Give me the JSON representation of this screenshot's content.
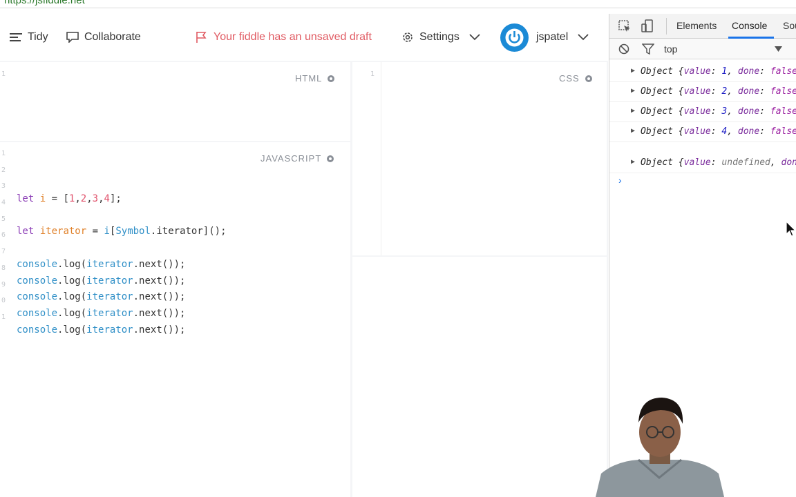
{
  "browser": {
    "url": "https://jsfiddle.net"
  },
  "toolbar": {
    "tidy": "Tidy",
    "collaborate": "Collaborate",
    "draft": "Your fiddle has an unsaved draft",
    "settings": "Settings",
    "user": "jspatel"
  },
  "panels": {
    "html_label": "HTML",
    "css_label": "CSS",
    "js_label": "JAVASCRIPT"
  },
  "line_numbers": {
    "html": [
      "1"
    ],
    "css": [
      "1"
    ],
    "js": [
      "1",
      "2",
      "3",
      "4",
      "5",
      "6",
      "7",
      "8",
      "9",
      "0",
      "1"
    ]
  },
  "code": {
    "line3": {
      "kw": "let",
      "var": "i",
      "eq": " = [",
      "n1": "1",
      "n2": "2",
      "n3": "3",
      "n4": "4",
      "end": "];"
    },
    "line5": {
      "kw": "let",
      "var": "iterator",
      "eq": " = ",
      "obj": "i",
      "open": "[",
      "sym": "Symbol",
      "rest": ".iterator]();"
    },
    "console_lines": [
      {
        "a": "console",
        "b": ".log(",
        "c": "iterator",
        "d": ".next());"
      },
      {
        "a": "console",
        "b": ".log(",
        "c": "iterator",
        "d": ".next());"
      },
      {
        "a": "console",
        "b": ".log(",
        "c": "iterator",
        "d": ".next());"
      },
      {
        "a": "console",
        "b": ".log(",
        "c": "iterator",
        "d": ".next());"
      },
      {
        "a": "console",
        "b": ".log(",
        "c": "iterator",
        "d": ".next());"
      }
    ]
  },
  "devtools": {
    "tabs": [
      "Elements",
      "Console",
      "Sources"
    ],
    "active_tab": "Console",
    "context": "top",
    "logs": [
      {
        "obj": "Object ",
        "open": "{",
        "k1": "value",
        "v1": "1",
        "k2": "done",
        "v2": "false"
      },
      {
        "obj": "Object ",
        "open": "{",
        "k1": "value",
        "v1": "2",
        "k2": "done",
        "v2": "false"
      },
      {
        "obj": "Object ",
        "open": "{",
        "k1": "value",
        "v1": "3",
        "k2": "done",
        "v2": "false"
      },
      {
        "obj": "Object ",
        "open": "{",
        "k1": "value",
        "v1": "4",
        "k2": "done",
        "v2": "false"
      },
      {
        "obj": "Object ",
        "open": "{",
        "k1": "value",
        "v1": "undefined",
        "k2": "done",
        "v2": "true"
      }
    ],
    "prompt": "›"
  },
  "colors": {
    "accent": "#1b8ad6",
    "draft": "#e05a62",
    "devtools_active": "#1a73e8"
  }
}
